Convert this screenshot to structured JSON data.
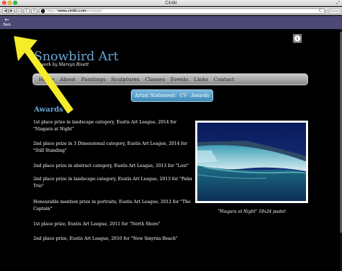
{
  "window": {
    "title": "Ciniki",
    "resize_glyph": "⤢"
  },
  "toolbar": {
    "back_glyph": "◀",
    "forward_glyph": "▶",
    "sidebar_glyph": "▭",
    "share_glyph": "⇪",
    "add_glyph": "+",
    "url_scheme": "https://",
    "url_host": "www.ciniki.com",
    "url_path": "/manager",
    "reload_glyph": "C",
    "reader_label": "Reader"
  },
  "overlay": {
    "back_arrow": "←",
    "back_label": "Back"
  },
  "site": {
    "title": "Snowbird Art",
    "subtitle": "Artwork by Marvyn Rivett",
    "info_glyph": "i"
  },
  "mainnav": {
    "items": [
      "Home",
      "About",
      "Paintings",
      "Sculptures",
      "Classes",
      "Events",
      "Links",
      "Contact"
    ]
  },
  "subnav": {
    "items": [
      "Artist Statement",
      "CV",
      "Awards"
    ]
  },
  "content": {
    "heading": "Awards",
    "awards": [
      "1st place prize in landscape category, Eustis Art League, 2014 for \"Niagara at Night\"",
      "2nd place prize in 3 Dimensional category, Eustis Art League, 2014 for \"Still Standing\"",
      "2nd place prize in abstract category, Eustis Art League, 2013 for \"Lost\"",
      "2nd place prize in landscape category, Eustis Art League, 2013 for \"Palm Trio\"",
      "Honourable mention prize in portraits, Eustis Art League, 2012 for \"The Captain\"",
      "1st place prize, Eustis Art League, 2011 for \"North Shore\"",
      "2nd place prize, Eustis Art League, 2010 for \"New Smyrna Beach\""
    ],
    "artwork_caption": "\"Niagara at Night\" 18x24 pastel"
  },
  "colors": {
    "accent": "#68a7d4",
    "back_strip": "#4c4a74",
    "pointer_arrow": "#f5ec2a"
  },
  "icons": {
    "pointer": "yellow-arrow-pointer",
    "info": "info-icon",
    "lock": "lock-icon"
  }
}
